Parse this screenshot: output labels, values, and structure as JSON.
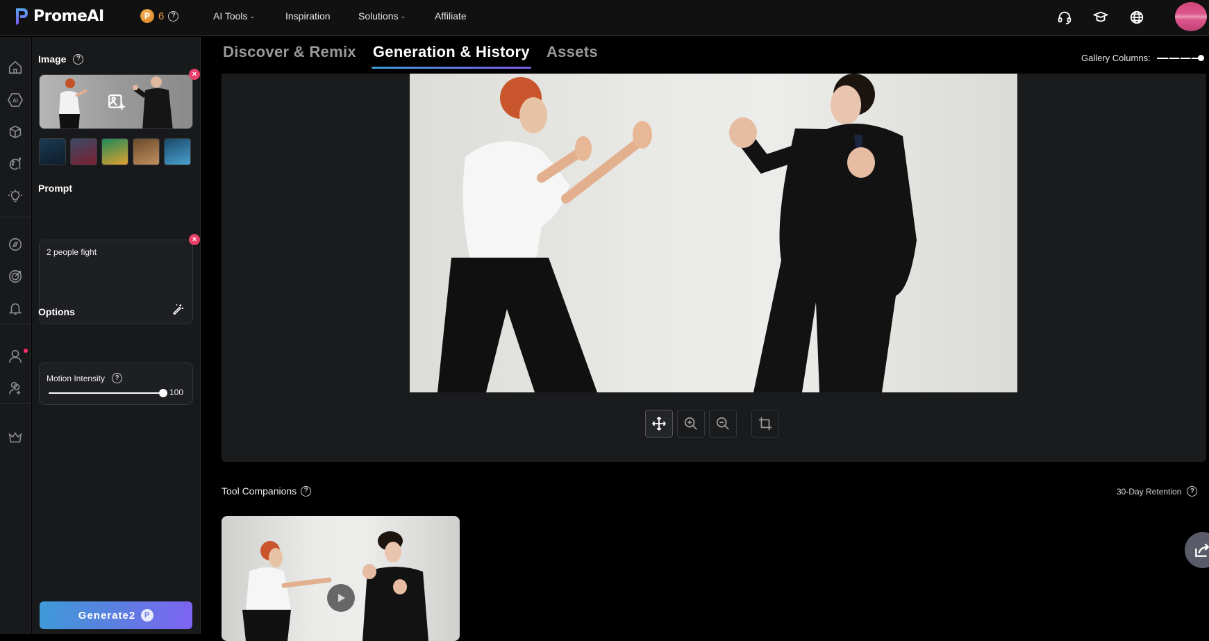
{
  "app": {
    "name": "PromeAI"
  },
  "header": {
    "credits": "6",
    "credit_coin_glyph": "P",
    "nav": [
      {
        "label": "AI Tools",
        "has_dropdown": true
      },
      {
        "label": "Inspiration",
        "has_dropdown": false
      },
      {
        "label": "Solutions",
        "has_dropdown": true
      },
      {
        "label": "Affiliate",
        "has_dropdown": false
      }
    ],
    "right_icons": [
      "headset-icon",
      "graduation-cap-icon",
      "globe-icon",
      "avatar"
    ]
  },
  "rail": {
    "items": [
      {
        "name": "home",
        "icon": "home-icon"
      },
      {
        "name": "ai",
        "icon": "ai-hexagon-icon",
        "glyph": "AI"
      },
      {
        "name": "3d",
        "icon": "cube-icon"
      },
      {
        "name": "design",
        "icon": "palette-icon"
      },
      {
        "name": "ideas",
        "icon": "lightbulb-icon"
      },
      {
        "name": "explore",
        "icon": "compass-icon"
      },
      {
        "name": "challenges",
        "icon": "target-icon"
      },
      {
        "name": "notifications",
        "icon": "bell-icon"
      },
      {
        "name": "profile",
        "icon": "user-icon",
        "has_notification": true
      },
      {
        "name": "invite",
        "icon": "user-add-icon"
      },
      {
        "name": "pricing",
        "icon": "crown-icon"
      }
    ]
  },
  "panel": {
    "image_section": {
      "title": "Image",
      "help": "?"
    },
    "upload": {
      "close": "×"
    },
    "sample_images": [
      {
        "name": "pirate-ship",
        "color_a": "#1b3a52",
        "color_b": "#0d1c2a"
      },
      {
        "name": "red-cloak",
        "color_a": "#3b4a66",
        "color_b": "#7a2030"
      },
      {
        "name": "green-fruits",
        "color_a": "#1e8a5a",
        "color_b": "#e0a030"
      },
      {
        "name": "woman-selfie",
        "color_a": "#6a4a2a",
        "color_b": "#c09060"
      },
      {
        "name": "perfume-bottle",
        "color_a": "#1a4a6a",
        "color_b": "#4aa0d0"
      }
    ],
    "prompt_section": {
      "title": "Prompt",
      "value": "2 people fight",
      "close": "×"
    },
    "options_section": {
      "title": "Options",
      "motion_intensity": {
        "label": "Motion Intensity",
        "help": "?",
        "value": "100",
        "fraction": 1.0
      }
    },
    "generate": {
      "label": "Generate",
      "cost": "2",
      "coin_glyph": "P"
    }
  },
  "main": {
    "tabs": [
      {
        "label": "Discover & Remix",
        "active": false
      },
      {
        "label": "Generation & History",
        "active": true
      },
      {
        "label": "Assets",
        "active": false
      }
    ],
    "gallery_columns": {
      "label": "Gallery Columns:",
      "fraction": 1.0
    },
    "viewer_tools": [
      "move-icon",
      "zoom-in-icon",
      "zoom-out-icon",
      "crop-icon"
    ],
    "tool_companions": {
      "title": "Tool Companions",
      "help": "?"
    },
    "retention": {
      "label": "30-Day Retention",
      "help": "?"
    }
  },
  "colors": {
    "accent_gradient_start": "#3e9ad8",
    "accent_gradient_end": "#7f63f2",
    "close_badge": "#e8406a",
    "credit_orange": "#f0a040",
    "notification_dot": "#ff2d6a"
  }
}
